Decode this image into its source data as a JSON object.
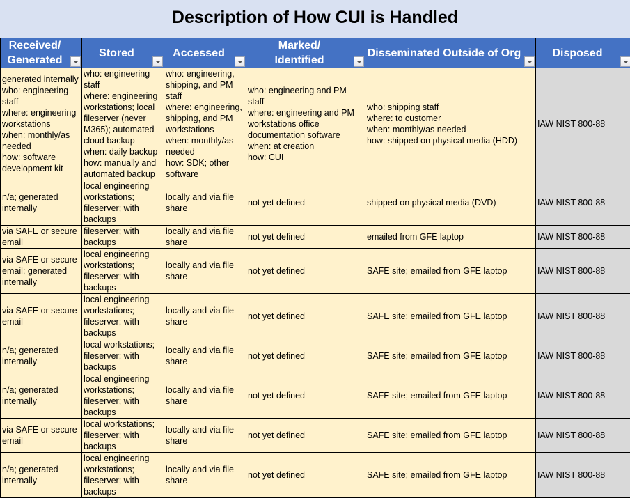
{
  "title": "Description of How CUI is Handled",
  "colors": {
    "header_bg": "#4472c4",
    "header_text": "#ffffff",
    "cell_bg": "#fff2cc",
    "disposed_bg": "#d9d9d9",
    "title_bg": "#d9e1f2"
  },
  "columns": [
    {
      "label": "Received/\nGenerated",
      "filter_icon": "filter-dropdown-icon"
    },
    {
      "label": "Stored",
      "filter_icon": "filter-dropdown-icon"
    },
    {
      "label": "Accessed",
      "filter_icon": "filter-dropdown-icon"
    },
    {
      "label": "Marked/\nIdentified",
      "filter_icon": "filter-dropdown-icon"
    },
    {
      "label": "Disseminated Outside of Org",
      "filter_icon": "filter-dropdown-icon"
    },
    {
      "label": "Disposed",
      "filter_icon": "filter-dropdown-icon"
    }
  ],
  "rows": [
    {
      "cells": [
        "generated internally\nwho: engineering staff\nwhere: engineering workstations\nwhen: monthly/as needed\nhow: software development kit",
        "who: engineering staff\nwhere: engineering workstations; local fileserver (never M365); automated cloud backup\nwhen: daily backup\nhow: manually and automated backup",
        "who: engineering, shipping, and PM staff\nwhere: engineering, shipping, and PM workstations\nwhen: monthly/as needed\nhow: SDK; other software",
        "who: engineering and PM staff\nwhere: engineering and PM workstations office documentation software\nwhen: at creation\nhow: CUI",
        "who: shipping staff\nwhere: to customer\nwhen: monthly/as needed\nhow: shipped on physical media (HDD)",
        "IAW NIST 800-88"
      ]
    },
    {
      "cells": [
        "n/a; generated internally",
        "local engineering workstations; fileserver; with backups",
        "locally and via file share",
        "not yet defined",
        "shipped on physical media (DVD)",
        "IAW NIST 800-88"
      ]
    },
    {
      "cells": [
        "via SAFE or secure email",
        "fileserver; with backups",
        "locally and via file share",
        "not yet defined",
        "emailed from GFE laptop",
        "IAW NIST 800-88"
      ]
    },
    {
      "cells": [
        "via SAFE or secure email; generated internally",
        "local engineering workstations; fileserver; with backups",
        "locally and via file share",
        "not yet defined",
        "SAFE site; emailed from GFE laptop",
        "IAW NIST 800-88"
      ]
    },
    {
      "cells": [
        "via SAFE or secure email",
        "local engineering workstations; fileserver; with backups",
        "locally and via file share",
        "not yet defined",
        "SAFE site; emailed from GFE laptop",
        "IAW NIST 800-88"
      ]
    },
    {
      "cells": [
        "n/a; generated internally",
        "local workstations; fileserver; with backups",
        "locally and via file share",
        "not yet defined",
        "SAFE site; emailed from GFE laptop",
        "IAW NIST 800-88"
      ]
    },
    {
      "cells": [
        "n/a; generated internally",
        "local engineering workstations; fileserver; with backups",
        "locally and via file share",
        "not yet defined",
        "SAFE site; emailed from GFE laptop",
        "IAW NIST 800-88"
      ]
    },
    {
      "cells": [
        "via SAFE or secure email",
        "local workstations; fileserver; with backups",
        "locally and via file share",
        "not yet defined",
        "SAFE site; emailed from GFE laptop",
        "IAW NIST 800-88"
      ]
    },
    {
      "cells": [
        "n/a; generated internally",
        "local engineering workstations; fileserver; with backups",
        "locally and via file share",
        "not yet defined",
        "SAFE site; emailed from GFE laptop",
        "IAW NIST 800-88"
      ]
    }
  ]
}
